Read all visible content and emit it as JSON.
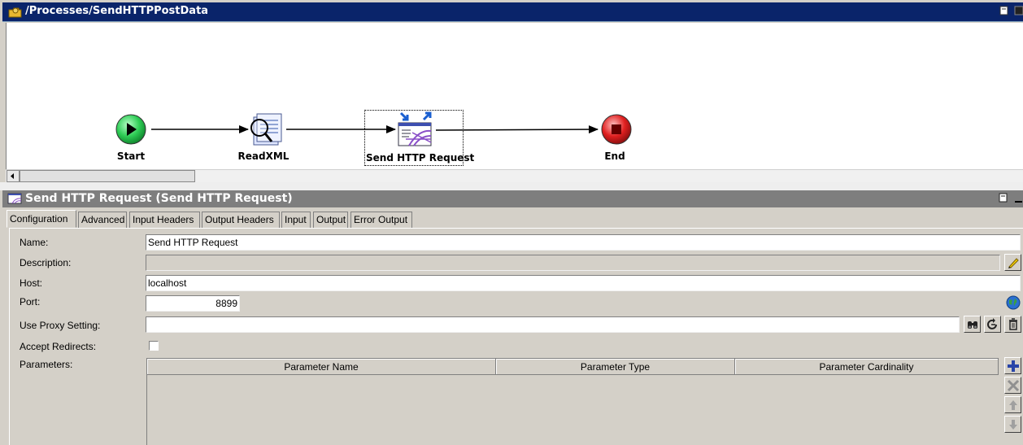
{
  "process": {
    "title": "/Processes/SendHTTPPostData",
    "nodes": {
      "start": "Start",
      "readxml": "ReadXML",
      "send_http": "Send HTTP Request",
      "end": "End"
    }
  },
  "panel": {
    "title": "Send HTTP Request (Send HTTP Request)",
    "tabs": [
      "Configuration",
      "Advanced",
      "Input Headers",
      "Output Headers",
      "Input",
      "Output",
      "Error Output"
    ],
    "active_tab": "Configuration",
    "fields": {
      "name_label": "Name:",
      "name_value": "Send HTTP Request",
      "description_label": "Description:",
      "description_value": "",
      "host_label": "Host:",
      "host_value": "localhost",
      "port_label": "Port:",
      "port_value": "8899",
      "proxy_label": "Use Proxy Setting:",
      "proxy_value": "",
      "redirects_label": "Accept Redirects:",
      "redirects_checked": false,
      "parameters_label": "Parameters:"
    },
    "parameters_table": {
      "columns": [
        "Parameter Name",
        "Parameter Type",
        "Parameter Cardinality"
      ],
      "rows": []
    }
  },
  "colors": {
    "titlebar_active": "#0a246a",
    "titlebar_inactive": "#7e7e7e",
    "start_node": "#2ecc55",
    "end_node": "#e02020"
  }
}
